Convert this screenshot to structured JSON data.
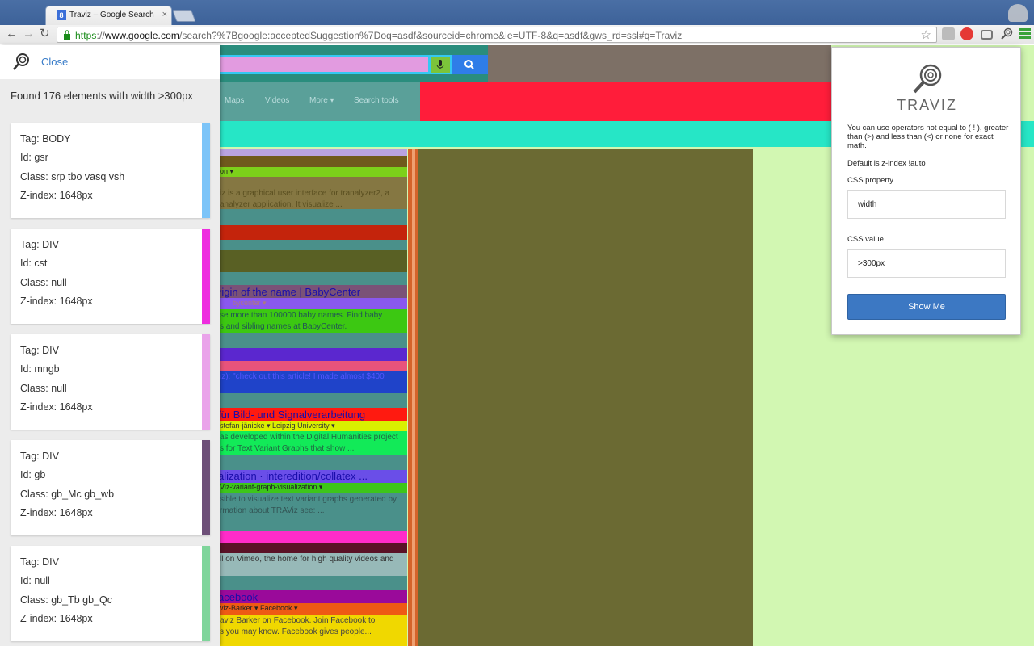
{
  "browser": {
    "tab_title": "Traviz – Google Search",
    "tab_favicon": "8",
    "url_scheme": "https",
    "url_domain": "www.google.com",
    "url_path": "/search?%7Bgoogle:acceptedSuggestion%7Doq=asdf&sourceid=chrome&ie=UTF-8&q=asdf&gws_rd=ssl#q=Traviz",
    "tab_close": "×"
  },
  "page": {
    "nav_maps": "Maps",
    "nav_videos": "Videos",
    "nav_more": "More ▾",
    "nav_search_tools": "Search tools",
    "results": [
      {
        "snippet1": "on ▾"
      },
      {
        "snippet1": "iz is a graphical user interface for tranalyzer2, a",
        "snippet2": "analyzer application. It visualize ..."
      },
      {
        "title": "rigin of the name | BabyCenter",
        "cite": "bycenter ▾",
        "snippet1": "se more than 100000 baby names. Find baby",
        "snippet2": "s and sibling names at BabyCenter."
      },
      {
        "snippet1": "iz): \"check out this article! I made almost $400"
      },
      {
        "title": "für Bild- und Signalverarbeitung",
        "cite": "stefan-jänicke ▾  Leipzig University ▾",
        "snippet1": "as developed within the Digital Humanities project",
        "snippet2": "s for Text Variant Graphs that show ..."
      },
      {
        "title": "alization · interedition/collatex ...",
        "cite": "Viz-variant-graph-visualization ▾",
        "snippet1": "sible to visualize text variant graphs generated by",
        "snippet2": "rmation about TRAViz see: ..."
      },
      {
        "snippet1": "ll on Vimeo, the home for high quality videos and"
      },
      {
        "title": "acebook",
        "cite": "viz-Barker ▾  Facebook ▾",
        "snippet1": "aviz Barker on Facebook. Join Facebook to",
        "snippet2": "s you may know. Facebook gives people..."
      }
    ]
  },
  "sidebar": {
    "close_label": "Close",
    "found_text": "Found 176 elements with width >300px",
    "cards": [
      {
        "tag": "Tag: BODY",
        "id": "Id: gsr",
        "class": "Class: srp tbo vasq vsh",
        "zindex": "Z-index: 1648px",
        "color": "#7cc4f8"
      },
      {
        "tag": "Tag: DIV",
        "id": "Id: cst",
        "class": "Class: null",
        "zindex": "Z-index: 1648px",
        "color": "#ee2ddf"
      },
      {
        "tag": "Tag: DIV",
        "id": "Id: mngb",
        "class": "Class: null",
        "zindex": "Z-index: 1648px",
        "color": "#eaa3ea"
      },
      {
        "tag": "Tag: DIV",
        "id": "Id: gb",
        "class": "Class: gb_Mc gb_wb",
        "zindex": "Z-index: 1648px",
        "color": "#6d4f78"
      },
      {
        "tag": "Tag: DIV",
        "id": "Id: null",
        "class": "Class: gb_Tb gb_Qc",
        "zindex": "Z-index: 1648px",
        "color": "#7fd59b"
      }
    ]
  },
  "popup": {
    "title": "TRAVIZ",
    "description": "You can use operators not equal to ( ! ), greater than (>) and less than (<) or none for exact math.",
    "default_text": "Default is z-index !auto",
    "property_label": "CSS property",
    "property_value": "width",
    "value_label": "CSS value",
    "value_value": ">300px",
    "button_label": "Show Me"
  }
}
